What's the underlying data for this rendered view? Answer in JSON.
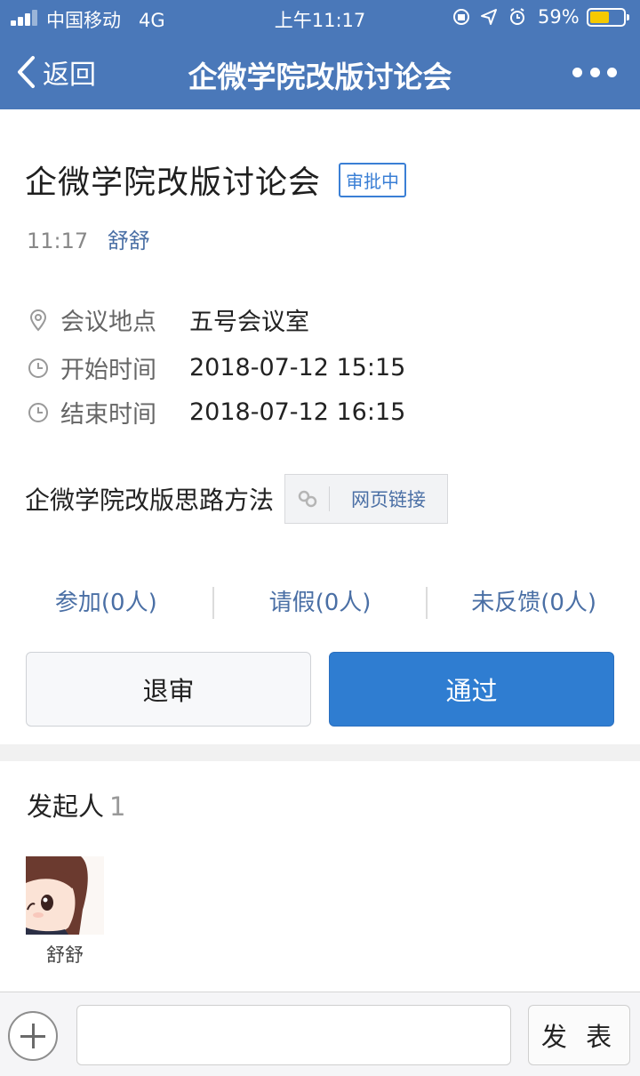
{
  "status_bar": {
    "carrier": "中国移动",
    "network": "4G",
    "time": "上午11:17",
    "battery_percent": "59%",
    "battery_level": 0.59,
    "icons": [
      "lock-rotation-icon",
      "location-arrow-icon",
      "alarm-icon"
    ]
  },
  "nav": {
    "back_label": "返回",
    "title": "企微学院改版讨论会",
    "more_icon": "more-dots-icon"
  },
  "meeting": {
    "title": "企微学院改版讨论会",
    "status_badge": "审批中",
    "time": "11:17",
    "author": "舒舒",
    "location_label": "会议地点",
    "location_value": "五号会议室",
    "start_label": "开始时间",
    "start_value": "2018-07-12 15:15",
    "end_label": "结束时间",
    "end_value": "2018-07-12 16:15",
    "attachment_text": "企微学院改版思路方法",
    "attachment_link": "网页链接"
  },
  "stats": [
    {
      "label": "参加(0人)"
    },
    {
      "label": "请假(0人)"
    },
    {
      "label": "未反馈(0人)"
    }
  ],
  "actions": {
    "reject": "退审",
    "approve": "通过"
  },
  "organizer": {
    "section_title": "发起人",
    "count": "1",
    "name": "舒舒"
  },
  "composer": {
    "input_value": "",
    "send_label": "发 表"
  },
  "colors": {
    "nav_bg": "#4a78b9",
    "accent": "#2f7dd1",
    "link": "#4a6fa5",
    "battery": "#f5c900"
  }
}
